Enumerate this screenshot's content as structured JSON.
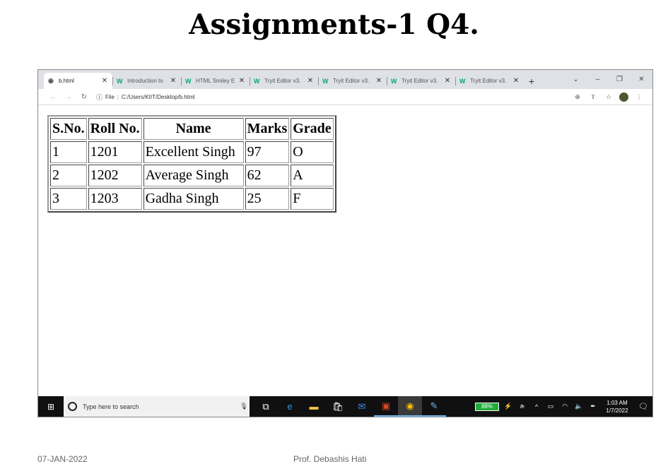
{
  "slide": {
    "title": "Assignments-1 Q4.",
    "footer_date": "07-JAN-2022",
    "footer_author": "Prof. Debashis Hati"
  },
  "browser": {
    "tabs": [
      {
        "label": "b.html",
        "icon": "globe-icon",
        "active": true
      },
      {
        "label": "Introduction to",
        "icon": "w3schools-icon",
        "active": false
      },
      {
        "label": "HTML Smiley E",
        "icon": "w3schools-icon",
        "active": false
      },
      {
        "label": "Tryit Editor v3.",
        "icon": "w3schools-icon",
        "active": false
      },
      {
        "label": "Tryit Editor v3.",
        "icon": "w3schools-icon",
        "active": false
      },
      {
        "label": "Tryit Editor v3.",
        "icon": "w3schools-icon",
        "active": false
      },
      {
        "label": "Tryit Editor v3.",
        "icon": "w3schools-icon",
        "active": false
      }
    ],
    "address": {
      "scheme": "File",
      "path": "C:/Users/KIIT/Desktop/b.html"
    }
  },
  "table": {
    "headers": [
      "S.No.",
      "Roll No.",
      "Name",
      "Marks",
      "Grade"
    ],
    "rows": [
      [
        "1",
        "1201",
        "Excellent Singh",
        "97",
        "O"
      ],
      [
        "2",
        "1202",
        "Average Singh",
        "62",
        "A"
      ],
      [
        "3",
        "1203",
        "Gadha Singh",
        "25",
        "F"
      ]
    ]
  },
  "taskbar": {
    "search_placeholder": "Type here to search",
    "battery": "88%",
    "time": "1:03 AM",
    "date": "1/7/2022"
  },
  "colors": {
    "tabstrip": "#dee1e6",
    "taskbar": "#101010",
    "battery": "#1faa3a",
    "w3schools": "#04aa6d"
  }
}
